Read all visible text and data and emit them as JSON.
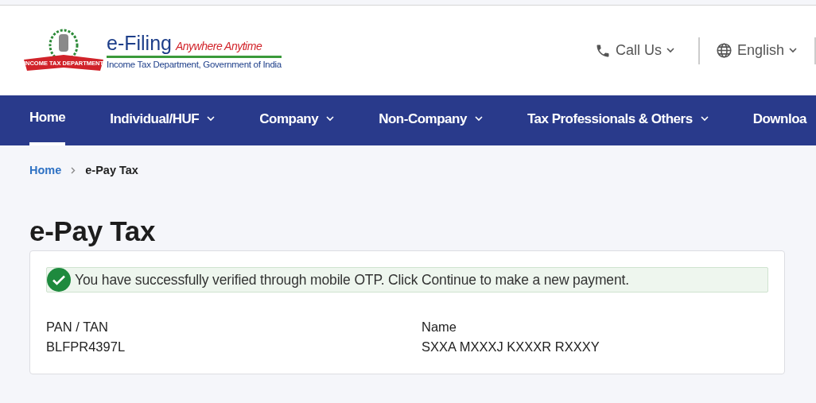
{
  "header": {
    "logo": {
      "title": "e-Filing",
      "tagline": "Anywhere Anytime",
      "subtitle": "Income Tax Department, Government of India",
      "ribbon": "INCOME TAX DEPARTMENT"
    },
    "actions": [
      {
        "label": "Call Us"
      },
      {
        "label": "English"
      }
    ]
  },
  "nav": [
    {
      "label": "Home",
      "selected": true,
      "dropdown": false
    },
    {
      "label": "Individual/HUF",
      "selected": false,
      "dropdown": true
    },
    {
      "label": "Company",
      "selected": false,
      "dropdown": true
    },
    {
      "label": "Non-Company",
      "selected": false,
      "dropdown": true
    },
    {
      "label": "Tax Professionals & Others",
      "selected": false,
      "dropdown": true
    },
    {
      "label": "Downloa",
      "selected": false,
      "dropdown": false
    }
  ],
  "breadcrumb": [
    {
      "label": "Home",
      "kind": "link"
    },
    {
      "label": "e-Pay Tax",
      "kind": "current"
    }
  ],
  "page_title": "e-Pay Tax",
  "card": {
    "alert": {
      "kind": "success",
      "message": "You have successfully verified through mobile OTP. Click Continue to make a new payment."
    },
    "fields": [
      {
        "label": "PAN / TAN",
        "value": "BLFPR4397L"
      },
      {
        "label": "Name",
        "value": "SXXA MXXXJ KXXXR RXXXY"
      }
    ]
  }
}
